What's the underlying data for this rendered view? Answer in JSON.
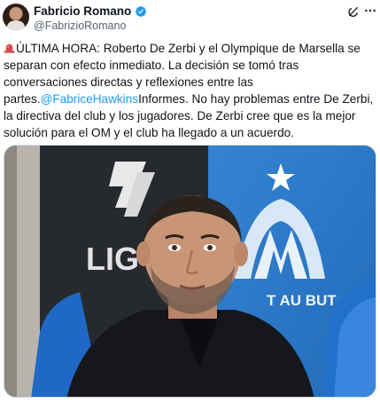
{
  "author": {
    "display_name": "Fabricio Romano",
    "handle": "@FabrizioRomano",
    "verified": true
  },
  "icons": {
    "verified": "verified-badge-icon",
    "grok": "grok-icon",
    "more": "more-options-icon",
    "siren": "siren-emoji-icon"
  },
  "tweet": {
    "part1": "ÚLTIMA HORA: Roberto De Zerbi y el Olympique de Marsella se separan con efecto inmediato. La decisión se tomó tras conversaciones directas y reflexiones entre las partes.",
    "mention": "@FabriceHawkins",
    "part2": "Informes. No hay problemas entre De Zerbi, la directiva del club y los jugadores. De Zerbi cree que es la mejor solución para el OM y el club ha llegado a un acuerdo."
  },
  "media": {
    "board_text": "LIG",
    "banner_text": "T AU BUT"
  },
  "colors": {
    "accent": "#1d9bf0",
    "text": "#0f1419",
    "muted": "#536471",
    "om_blue": "#2a7bcf"
  }
}
